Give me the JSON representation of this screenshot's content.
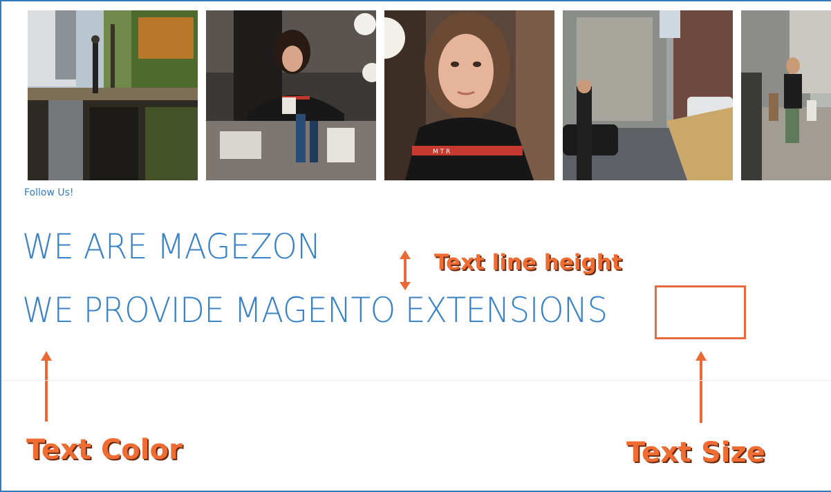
{
  "links": {
    "follow_us": "Follow Us!"
  },
  "headings": {
    "line1": "WE ARE MAGEZON",
    "line2": "WE PROVIDE MAGENTO EXTENSIONS"
  },
  "annotations": {
    "line_height": "Text line height",
    "color": "Text Color",
    "size": "Text Size"
  },
  "colors": {
    "text_blue": "#3a82c6",
    "annotation_orange": "#ef6c33"
  }
}
